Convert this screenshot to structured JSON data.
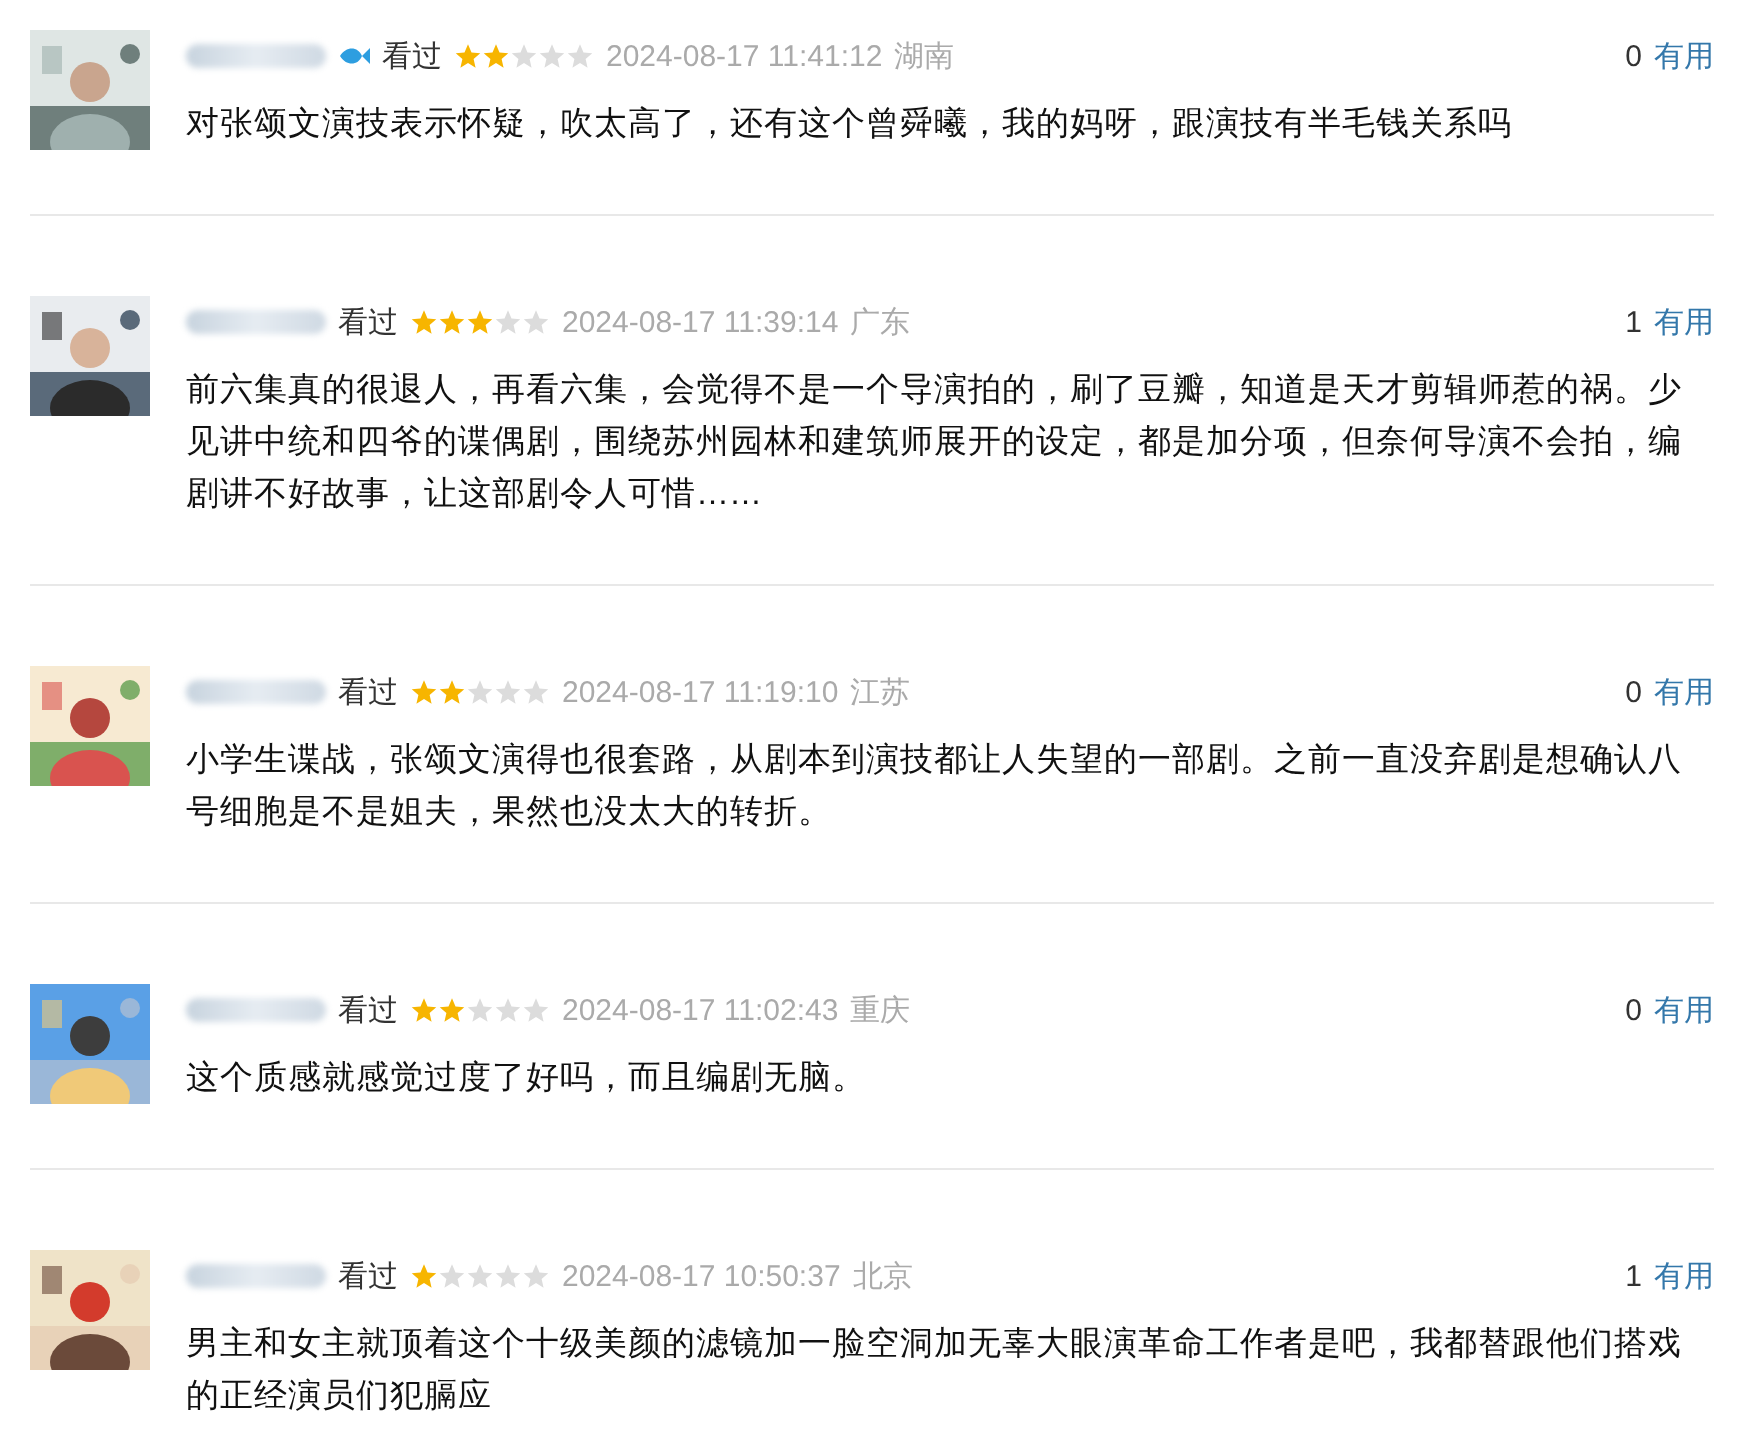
{
  "comments": [
    {
      "name_blurred": true,
      "vip_badge": true,
      "status": "看过",
      "stars": 2,
      "time": "2024-08-17 11:41:12",
      "location": "湖南",
      "votes": "0",
      "useful_label": "有用",
      "text": "对张颂文演技表示怀疑，吹太高了，还有这个曾舜曦，我的妈呀，跟演技有半毛钱关系吗"
    },
    {
      "name_blurred": true,
      "vip_badge": false,
      "status": "看过",
      "stars": 3,
      "time": "2024-08-17 11:39:14",
      "location": "广东",
      "votes": "1",
      "useful_label": "有用",
      "text": "前六集真的很退人，再看六集，会觉得不是一个导演拍的，刷了豆瓣，知道是天才剪辑师惹的祸。少见讲中统和四爷的谍偶剧，围绕苏州园林和建筑师展开的设定，都是加分项，但奈何导演不会拍，编剧讲不好故事，让这部剧令人可惜……"
    },
    {
      "name_blurred": true,
      "vip_badge": false,
      "status": "看过",
      "stars": 2,
      "time": "2024-08-17 11:19:10",
      "location": "江苏",
      "votes": "0",
      "useful_label": "有用",
      "text": "小学生谍战，张颂文演得也很套路，从剧本到演技都让人失望的一部剧。之前一直没弃剧是想确认八号细胞是不是姐夫，果然也没太大的转折。"
    },
    {
      "name_blurred": true,
      "vip_badge": false,
      "status": "看过",
      "stars": 2,
      "time": "2024-08-17 11:02:43",
      "location": "重庆",
      "votes": "0",
      "useful_label": "有用",
      "text": "这个质感就感觉过度了好吗，而且编剧无脑。"
    },
    {
      "name_blurred": true,
      "vip_badge": false,
      "status": "看过",
      "stars": 1,
      "time": "2024-08-17 10:50:37",
      "location": "北京",
      "votes": "1",
      "useful_label": "有用",
      "text": "男主和女主就顶着这个十级美颜的滤镜加一脸空洞加无辜大眼演革命工作者是吧，我都替跟他们搭戏的正经演员们犯膈应"
    }
  ]
}
